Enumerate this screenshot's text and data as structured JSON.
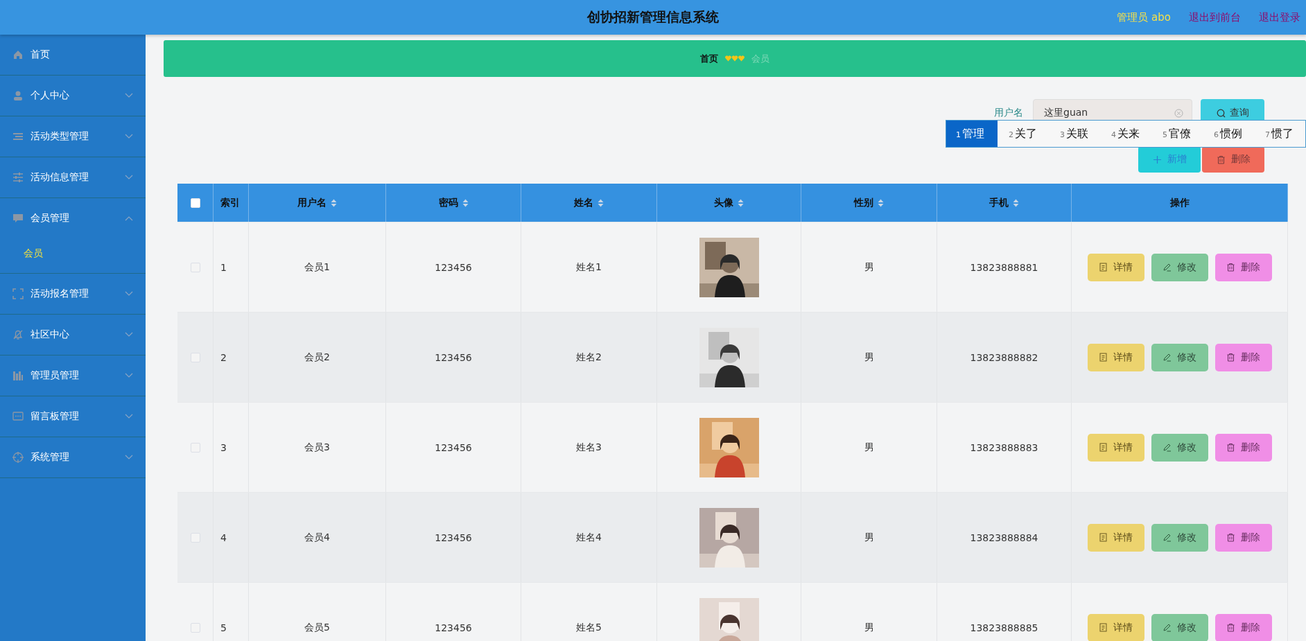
{
  "header": {
    "title": "创协招新管理信息系统",
    "user": "管理员 abo",
    "links": [
      "退出到前台",
      "退出登录"
    ]
  },
  "sidebar": {
    "items": [
      {
        "label": "首页",
        "expandable": false
      },
      {
        "label": "个人中心",
        "expandable": true,
        "expanded": false
      },
      {
        "label": "活动类型管理",
        "expandable": true,
        "expanded": false
      },
      {
        "label": "活动信息管理",
        "expandable": true,
        "expanded": false
      },
      {
        "label": "会员管理",
        "expandable": true,
        "expanded": true,
        "children": [
          {
            "label": "会员",
            "selected": true
          }
        ]
      },
      {
        "label": "活动报名管理",
        "expandable": true,
        "expanded": false
      },
      {
        "label": "社区中心",
        "expandable": true,
        "expanded": false
      },
      {
        "label": "管理员管理",
        "expandable": true,
        "expanded": false
      },
      {
        "label": "留言板管理",
        "expandable": true,
        "expanded": false
      },
      {
        "label": "系统管理",
        "expandable": true,
        "expanded": false
      }
    ]
  },
  "breadcrumb": [
    {
      "label": "首页",
      "current": false
    },
    {
      "label": "会员",
      "current": true
    }
  ],
  "search": {
    "label": "用户名",
    "value": "这里guan",
    "button": "查询"
  },
  "ime": {
    "candidates": [
      {
        "index": "1",
        "text": "管理",
        "selected": true
      },
      {
        "index": "2",
        "text": "关了",
        "selected": false
      },
      {
        "index": "3",
        "text": "关联",
        "selected": false
      },
      {
        "index": "4",
        "text": "关来",
        "selected": false
      },
      {
        "index": "5",
        "text": "官僚",
        "selected": false
      },
      {
        "index": "6",
        "text": "惯例",
        "selected": false
      },
      {
        "index": "7",
        "text": "惯了",
        "selected": false
      }
    ]
  },
  "actions": [
    {
      "label": "新增",
      "kind": "add"
    },
    {
      "label": "删除",
      "kind": "delete"
    }
  ],
  "table": {
    "all_checked": false,
    "columns": [
      {
        "label": "索引",
        "sortable": false
      },
      {
        "label": "用户名",
        "sortable": true
      },
      {
        "label": "密码",
        "sortable": true
      },
      {
        "label": "姓名",
        "sortable": true
      },
      {
        "label": "头像",
        "sortable": true
      },
      {
        "label": "性别",
        "sortable": true
      },
      {
        "label": "手机",
        "sortable": true
      },
      {
        "label": "操作",
        "sortable": false
      }
    ],
    "rows": [
      {
        "checked": false,
        "index": "1",
        "username": "会员1",
        "password": "123456",
        "name": "姓名1",
        "gender": "男",
        "phone": "13823888881",
        "buttons": [
          {
            "label": "详情",
            "kind": "detail"
          },
          {
            "label": "修改",
            "kind": "edit"
          },
          {
            "label": "删除",
            "kind": "delete"
          }
        ]
      },
      {
        "checked": false,
        "index": "2",
        "username": "会员2",
        "password": "123456",
        "name": "姓名2",
        "gender": "男",
        "phone": "13823888882",
        "buttons": [
          {
            "label": "详情",
            "kind": "detail"
          },
          {
            "label": "修改",
            "kind": "edit"
          },
          {
            "label": "删除",
            "kind": "delete"
          }
        ]
      },
      {
        "checked": false,
        "index": "3",
        "username": "会员3",
        "password": "123456",
        "name": "姓名3",
        "gender": "男",
        "phone": "13823888883",
        "buttons": [
          {
            "label": "详情",
            "kind": "detail"
          },
          {
            "label": "修改",
            "kind": "edit"
          },
          {
            "label": "删除",
            "kind": "delete"
          }
        ]
      },
      {
        "checked": false,
        "index": "4",
        "username": "会员4",
        "password": "123456",
        "name": "姓名4",
        "gender": "男",
        "phone": "13823888884",
        "buttons": [
          {
            "label": "详情",
            "kind": "detail"
          },
          {
            "label": "修改",
            "kind": "edit"
          },
          {
            "label": "删除",
            "kind": "delete"
          }
        ]
      },
      {
        "checked": false,
        "index": "5",
        "username": "会员5",
        "password": "123456",
        "name": "姓名5",
        "gender": "男",
        "phone": "13823888885",
        "buttons": [
          {
            "label": "详情",
            "kind": "detail"
          },
          {
            "label": "修改",
            "kind": "edit"
          },
          {
            "label": "删除",
            "kind": "delete"
          }
        ]
      }
    ]
  }
}
